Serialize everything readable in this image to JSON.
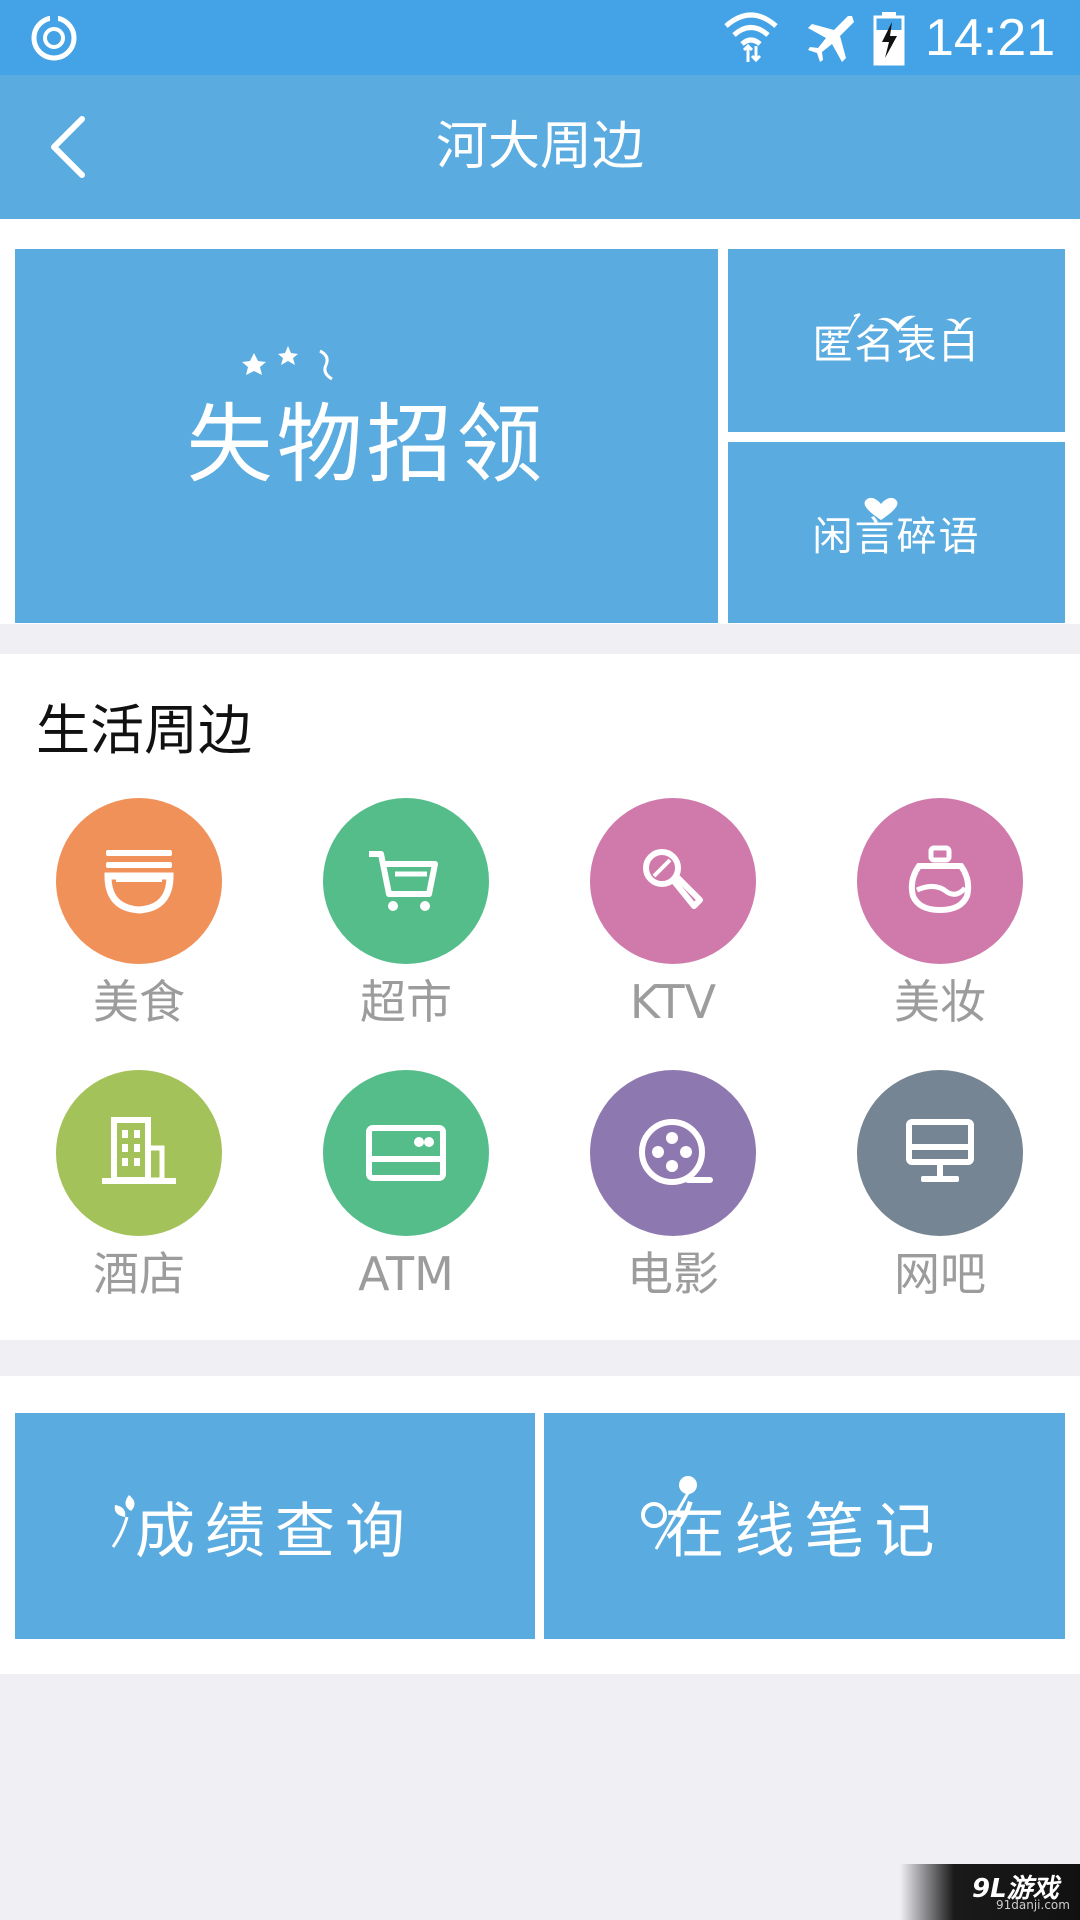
{
  "status_bar": {
    "time": "14:21",
    "icons": [
      "sync-icon",
      "wifi-icon",
      "airplane-mode-icon",
      "battery-charging-icon"
    ]
  },
  "app_bar": {
    "title": "河大周边",
    "back_icon": "back-chevron-icon"
  },
  "top_tiles": {
    "lost_found": "失物招领",
    "anonymous_confession": "匿名表白",
    "idle_chat": "闲言碎语"
  },
  "life": {
    "title": "生活周边",
    "categories": [
      {
        "label": "美食",
        "icon": "noodle-bowl-icon",
        "color": "#f0915a"
      },
      {
        "label": "超市",
        "icon": "shopping-cart-icon",
        "color": "#55bd8a"
      },
      {
        "label": "KTV",
        "icon": "microphone-icon",
        "color": "#d07aac"
      },
      {
        "label": "美妆",
        "icon": "perfume-bottle-icon",
        "color": "#d07aac"
      },
      {
        "label": "酒店",
        "icon": "hotel-building-icon",
        "color": "#a4c25a"
      },
      {
        "label": "ATM",
        "icon": "bank-card-icon",
        "color": "#55bd8a"
      },
      {
        "label": "电影",
        "icon": "film-reel-icon",
        "color": "#8e78b0"
      },
      {
        "label": "网吧",
        "icon": "computer-monitor-icon",
        "color": "#758593"
      }
    ]
  },
  "bottom_tiles": {
    "score_query": "成绩查询",
    "online_notes": "在线笔记"
  },
  "watermark": {
    "brand": "9L游戏",
    "site": "91danji.com"
  },
  "colors": {
    "status_bar": "#43a3e6",
    "primary_tile": "#5aabe0",
    "background": "#efeff4",
    "label_gray": "#9c9c9c"
  }
}
